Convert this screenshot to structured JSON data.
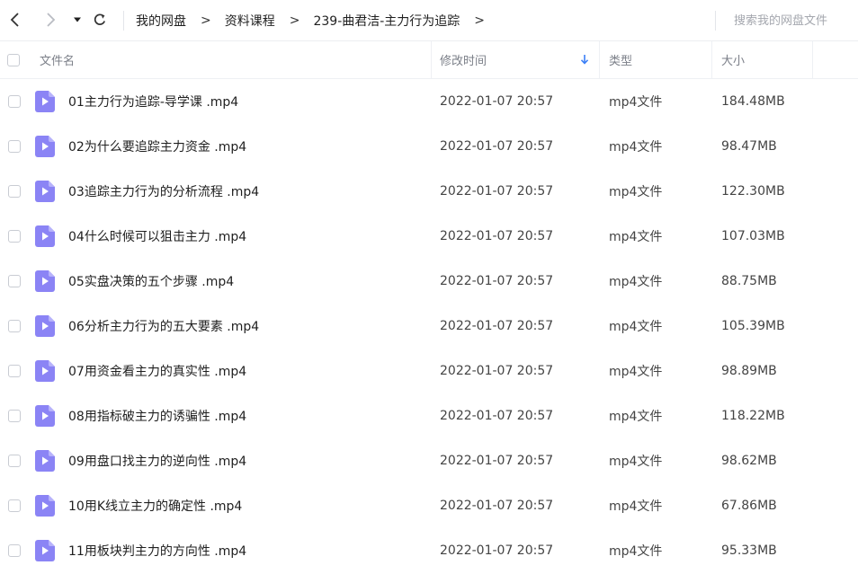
{
  "nav": {
    "breadcrumb": [
      "我的网盘",
      "资料课程",
      "239-曲君洁-主力行为追踪"
    ],
    "separator": ">"
  },
  "search": {
    "placeholder": "搜索我的网盘文件"
  },
  "table": {
    "columns": {
      "name": "文件名",
      "modified": "修改时间",
      "type": "类型",
      "size": "大小"
    },
    "rows": [
      {
        "name": "01主力行为追踪-导学课 .mp4",
        "modified": "2022-01-07 20:57",
        "type": "mp4文件",
        "size": "184.48MB"
      },
      {
        "name": "02为什么要追踪主力资金 .mp4",
        "modified": "2022-01-07 20:57",
        "type": "mp4文件",
        "size": "98.47MB"
      },
      {
        "name": "03追踪主力行为的分析流程 .mp4",
        "modified": "2022-01-07 20:57",
        "type": "mp4文件",
        "size": "122.30MB"
      },
      {
        "name": "04什么时候可以狙击主力 .mp4",
        "modified": "2022-01-07 20:57",
        "type": "mp4文件",
        "size": "107.03MB"
      },
      {
        "name": "05实盘决策的五个步骤 .mp4",
        "modified": "2022-01-07 20:57",
        "type": "mp4文件",
        "size": "88.75MB"
      },
      {
        "name": "06分析主力行为的五大要素 .mp4",
        "modified": "2022-01-07 20:57",
        "type": "mp4文件",
        "size": "105.39MB"
      },
      {
        "name": "07用资金看主力的真实性 .mp4",
        "modified": "2022-01-07 20:57",
        "type": "mp4文件",
        "size": "98.89MB"
      },
      {
        "name": "08用指标破主力的诱骗性 .mp4",
        "modified": "2022-01-07 20:57",
        "type": "mp4文件",
        "size": "118.22MB"
      },
      {
        "name": "09用盘口找主力的逆向性 .mp4",
        "modified": "2022-01-07 20:57",
        "type": "mp4文件",
        "size": "98.62MB"
      },
      {
        "name": "10用K线立主力的确定性 .mp4",
        "modified": "2022-01-07 20:57",
        "type": "mp4文件",
        "size": "67.86MB"
      },
      {
        "name": "11用板块判主力的方向性 .mp4",
        "modified": "2022-01-07 20:57",
        "type": "mp4文件",
        "size": "95.33MB"
      }
    ]
  },
  "colors": {
    "accent": "#3b7ff6",
    "video_icon": "#8b84f5",
    "text_primary": "#1f1f1f",
    "text_muted": "#7b7f88"
  },
  "icons": {
    "back": "chevron-left-icon",
    "forward": "chevron-right-icon",
    "history": "caret-down-icon",
    "refresh": "refresh-icon",
    "sort": "arrow-down-icon",
    "file": "video-file-icon"
  }
}
